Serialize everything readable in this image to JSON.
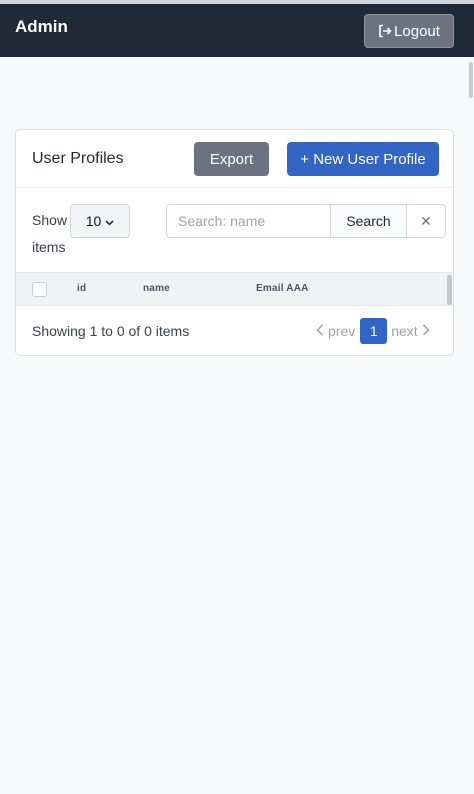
{
  "header": {
    "brand": "Admin",
    "logout_label": "Logout"
  },
  "card": {
    "title": "User Profiles",
    "export_label": "Export",
    "new_label": "+ New User Profile"
  },
  "controls": {
    "show_label": "Show",
    "page_size": "10",
    "items_label": "items",
    "search_placeholder": "Search: name",
    "search_value": "",
    "search_button": "Search",
    "clear_symbol": "✕"
  },
  "table": {
    "columns": [
      "id",
      "name",
      "Email AAA"
    ],
    "rows": []
  },
  "footer": {
    "showing": "Showing 1 to 0 of 0 items",
    "prev_label": "prev",
    "current_page": "1",
    "next_label": "next"
  },
  "colors": {
    "topbar": "#1f2937",
    "primary": "#3366c4",
    "secondary": "#6b7280"
  }
}
